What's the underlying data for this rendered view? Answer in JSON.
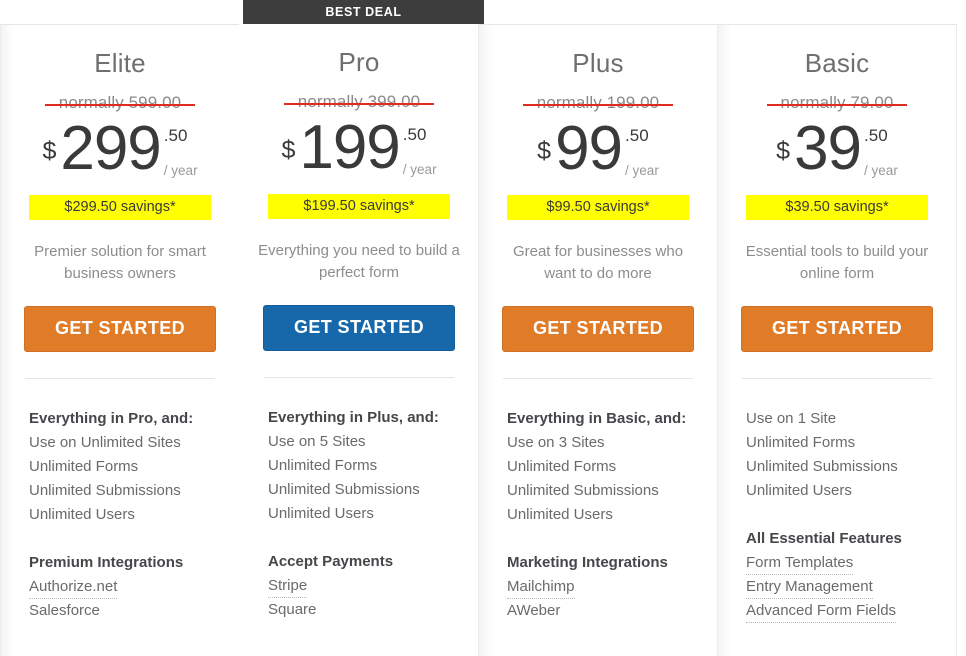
{
  "banner": {
    "best_deal_label": "BEST DEAL"
  },
  "currency_symbol": "$",
  "period_label": "/ year",
  "plans": [
    {
      "id": "elite",
      "name": "Elite",
      "normally": "normally 599.00",
      "price_whole": "299",
      "price_cents": ".50",
      "savings": "$299.50 savings*",
      "tagline": "Premier solution for smart business owners",
      "cta_label": "GET STARTED",
      "cta_style": "orange",
      "featured": false,
      "group1_heading": "Everything in Pro, and:",
      "group1_items": [
        "Use on Unlimited Sites",
        "Unlimited Forms",
        "Unlimited Submissions",
        "Unlimited Users"
      ],
      "group2_heading": "Premium Integrations",
      "group2_items": [
        {
          "label": "Authorize.net",
          "tooltip": true
        },
        {
          "label": "Salesforce",
          "tooltip": false
        }
      ]
    },
    {
      "id": "pro",
      "name": "Pro",
      "normally": "normally 399.00",
      "price_whole": "199",
      "price_cents": ".50",
      "savings": "$199.50 savings*",
      "tagline": "Everything you need to build a perfect form",
      "cta_label": "GET STARTED",
      "cta_style": "blue",
      "featured": true,
      "group1_heading": "Everything in Plus, and:",
      "group1_items": [
        "Use on 5 Sites",
        "Unlimited Forms",
        "Unlimited Submissions",
        "Unlimited Users"
      ],
      "group2_heading": "Accept Payments",
      "group2_items": [
        {
          "label": "Stripe",
          "tooltip": true
        },
        {
          "label": "Square",
          "tooltip": false
        }
      ]
    },
    {
      "id": "plus",
      "name": "Plus",
      "normally": "normally 199.00",
      "price_whole": "99",
      "price_cents": ".50",
      "savings": "$99.50 savings*",
      "tagline": "Great for businesses who want to do more",
      "cta_label": "GET STARTED",
      "cta_style": "orange",
      "featured": false,
      "group1_heading": "Everything in Basic, and:",
      "group1_items": [
        "Use on 3 Sites",
        "Unlimited Forms",
        "Unlimited Submissions",
        "Unlimited Users"
      ],
      "group2_heading": "Marketing Integrations",
      "group2_items": [
        {
          "label": "Mailchimp",
          "tooltip": true
        },
        {
          "label": "AWeber",
          "tooltip": false
        }
      ]
    },
    {
      "id": "basic",
      "name": "Basic",
      "normally": "normally 79.00",
      "price_whole": "39",
      "price_cents": ".50",
      "savings": "$39.50 savings*",
      "tagline": "Essential tools to build your online form",
      "cta_label": "GET STARTED",
      "cta_style": "orange",
      "featured": false,
      "group1_heading": "",
      "group1_items": [
        "Use on 1 Site",
        "Unlimited Forms",
        "Unlimited Submissions",
        "Unlimited Users"
      ],
      "group2_heading": "All Essential Features",
      "group2_items": [
        {
          "label": "Form Templates",
          "tooltip": true
        },
        {
          "label": "Entry Management",
          "tooltip": true
        },
        {
          "label": "Advanced Form Fields",
          "tooltip": true
        }
      ]
    }
  ],
  "colors": {
    "cta_orange": "#e07b28",
    "cta_blue": "#1668ab",
    "savings_yellow": "#ffff00",
    "banner_dark": "#3d3d3d",
    "strike_red": "#e02b20"
  }
}
